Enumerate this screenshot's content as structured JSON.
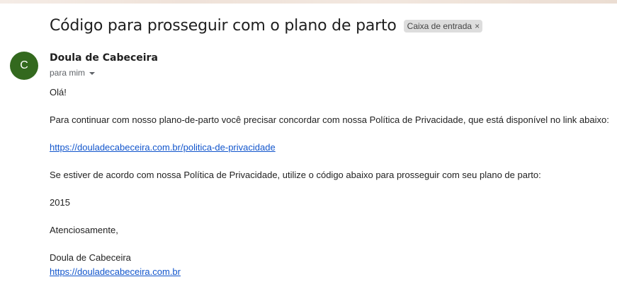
{
  "email": {
    "subject": "Código para prosseguir com o plano de parto",
    "label": "Caixa de entrada",
    "label_remove": "×",
    "sender": {
      "initial": "C",
      "avatar_color": "#33691e",
      "name": "Doula de Cabeceira",
      "recipient_text": "para mim"
    },
    "body": {
      "greeting": "Olá!",
      "paragraph1": "Para continuar com nosso plano-de-parto você precisar concordar com nossa Política de Privacidade, que está disponível no link abaixo:",
      "privacy_link": "https://douladecabeceira.com.br/politica-de-privacidade",
      "paragraph2": "Se estiver de acordo com nossa Política de Privacidade, utilize o código abaixo para prosseguir com seu plano de parto:",
      "code": "2015",
      "closing": "Atenciosamente,",
      "signature_name": "Doula de Cabeceira",
      "signature_link": "https://douladecabeceira.com.br"
    }
  },
  "colors": {
    "link": "#1155cc",
    "chip_bg": "#dddddd"
  }
}
